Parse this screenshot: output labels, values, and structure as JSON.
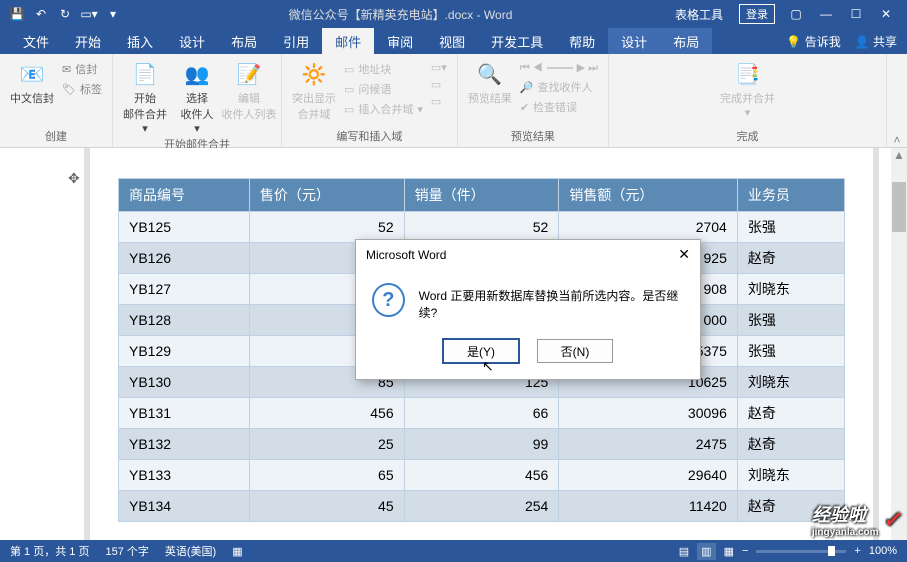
{
  "title": "微信公众号【新精英充电站】.docx - Word",
  "qat": [
    "save",
    "undo",
    "redo",
    "repeat",
    "customize"
  ],
  "contextTool": "表格工具",
  "login": "登录",
  "tabs": [
    "文件",
    "开始",
    "插入",
    "设计",
    "布局",
    "引用",
    "邮件",
    "审阅",
    "视图",
    "开发工具",
    "帮助"
  ],
  "contextTabs": [
    "设计",
    "布局"
  ],
  "tellMe": "告诉我",
  "share": "共享",
  "ribbon": {
    "g1": {
      "label": "创建",
      "b1": "中文信封",
      "b2": "信封",
      "b3": "标签"
    },
    "g2": {
      "label": "开始邮件合并",
      "b1": "开始\n邮件合并",
      "b2": "选择\n收件人",
      "b3": "编辑\n收件人列表"
    },
    "g3": {
      "label": "编写和插入域",
      "a": "突出显示\n合并域",
      "b": "地址块",
      "c": "问候语",
      "d": "插入合并域"
    },
    "g4": {
      "label": "预览结果",
      "a": "预览结果",
      "b": "查找收件人",
      "c": "检查错误"
    },
    "g5": {
      "label": "完成",
      "a": "完成并合并"
    }
  },
  "tableHeaders": [
    "商品编号",
    "售价（元）",
    "销量（件）",
    "销售额（元）",
    "业务员"
  ],
  "rows": [
    {
      "id": "YB125",
      "price": 52,
      "qty": 52,
      "amt": 2704,
      "rep": "张强"
    },
    {
      "id": "YB126",
      "price": "",
      "qty": "",
      "amt": "925",
      "rep": "赵奇"
    },
    {
      "id": "YB127",
      "price": "",
      "qty": "",
      "amt": "908",
      "rep": "刘晓东"
    },
    {
      "id": "YB128",
      "price": "",
      "qty": "",
      "amt": "000",
      "rep": "张强"
    },
    {
      "id": "YB129",
      "price": "",
      "qty": "",
      "amt": "15375",
      "rep": "张强"
    },
    {
      "id": "YB130",
      "price": 85,
      "qty": 125,
      "amt": 10625,
      "rep": "刘晓东"
    },
    {
      "id": "YB131",
      "price": 456,
      "qty": 66,
      "amt": 30096,
      "rep": "赵奇"
    },
    {
      "id": "YB132",
      "price": 25,
      "qty": 99,
      "amt": 2475,
      "rep": "赵奇"
    },
    {
      "id": "YB133",
      "price": 65,
      "qty": 456,
      "amt": 29640,
      "rep": "刘晓东"
    },
    {
      "id": "YB134",
      "price": 45,
      "qty": 254,
      "amt": 11420,
      "rep": "赵奇"
    }
  ],
  "dialog": {
    "title": "Microsoft Word",
    "msg": "Word 正要用新数据库替换当前所选内容。是否继续?",
    "yes": "是(Y)",
    "no": "否(N)"
  },
  "status": {
    "page": "第 1 页，共 1 页",
    "words": "157 个字",
    "lang": "英语(美国)",
    "zoom": "100%",
    "zoomPlus": "+"
  },
  "watermark": {
    "t": "经验啦",
    "s": "jingyanla.com"
  }
}
